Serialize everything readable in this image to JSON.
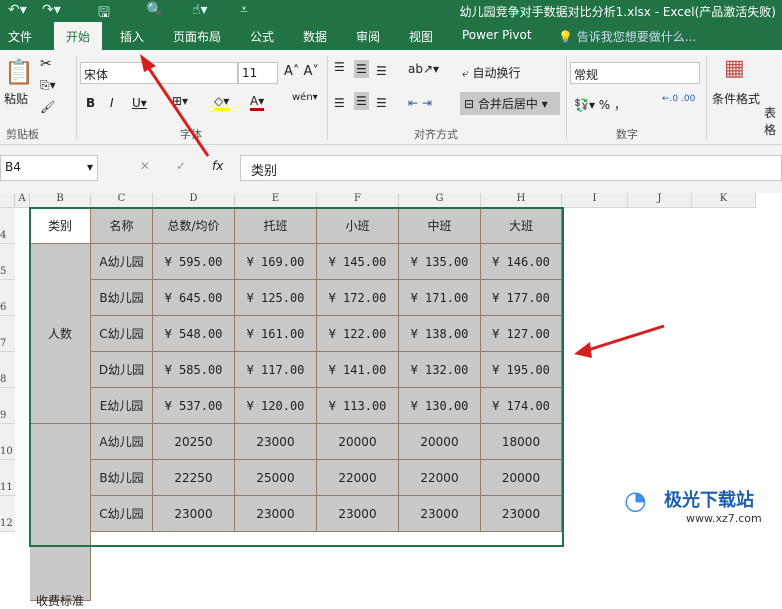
{
  "titlebar": {
    "title": "幼儿园竞争对手数据对比分析1.xlsx - Excel(产品激活失败)"
  },
  "tabs": [
    "文件",
    "开始",
    "插入",
    "页面布局",
    "公式",
    "数据",
    "审阅",
    "视图",
    "Power Pivot"
  ],
  "tell_me": "告诉我您想要做什么...",
  "ribbon": {
    "paste": "粘贴",
    "font_name": "宋体",
    "font_size": "11",
    "wrap_text": "自动换行",
    "merge_center": "合并后居中",
    "number_format": "常规",
    "cond_format": "条件格式",
    "table_format": "表格",
    "groups": {
      "clipboard": "剪贴板",
      "font": "字体",
      "alignment": "对齐方式",
      "number": "数字"
    }
  },
  "formula": {
    "name_box": "B4",
    "content": "类别"
  },
  "columns": [
    "A",
    "B",
    "C",
    "D",
    "E",
    "F",
    "G",
    "H",
    "I",
    "J",
    "K"
  ],
  "rows": [
    "4",
    "5",
    "6",
    "7",
    "8",
    "9",
    "10",
    "11",
    "12"
  ],
  "table": {
    "headers": [
      "类别",
      "名称",
      "总数/均价",
      "托班",
      "小班",
      "中班",
      "大班"
    ],
    "groups": [
      {
        "label": "人数",
        "rows": [
          [
            "A幼儿园",
            "¥ 595.00",
            "¥ 169.00",
            "¥ 145.00",
            "¥ 135.00",
            "¥ 146.00"
          ],
          [
            "B幼儿园",
            "¥ 645.00",
            "¥ 125.00",
            "¥ 172.00",
            "¥ 171.00",
            "¥ 177.00"
          ],
          [
            "C幼儿园",
            "¥ 548.00",
            "¥ 161.00",
            "¥ 122.00",
            "¥ 138.00",
            "¥ 127.00"
          ],
          [
            "D幼儿园",
            "¥ 585.00",
            "¥ 117.00",
            "¥ 141.00",
            "¥ 132.00",
            "¥ 195.00"
          ],
          [
            "E幼儿园",
            "¥ 537.00",
            "¥ 120.00",
            "¥ 113.00",
            "¥ 130.00",
            "¥ 174.00"
          ]
        ]
      },
      {
        "label": "收费标准",
        "rows": [
          [
            "A幼儿园",
            "20250",
            "23000",
            "20000",
            "20000",
            "18000"
          ],
          [
            "B幼儿园",
            "22250",
            "25000",
            "22000",
            "22000",
            "20000"
          ],
          [
            "C幼儿园",
            "23000",
            "23000",
            "23000",
            "23000",
            "23000"
          ]
        ]
      }
    ]
  },
  "watermark": {
    "name": "极光下载站",
    "url": "www.xz7.com"
  }
}
